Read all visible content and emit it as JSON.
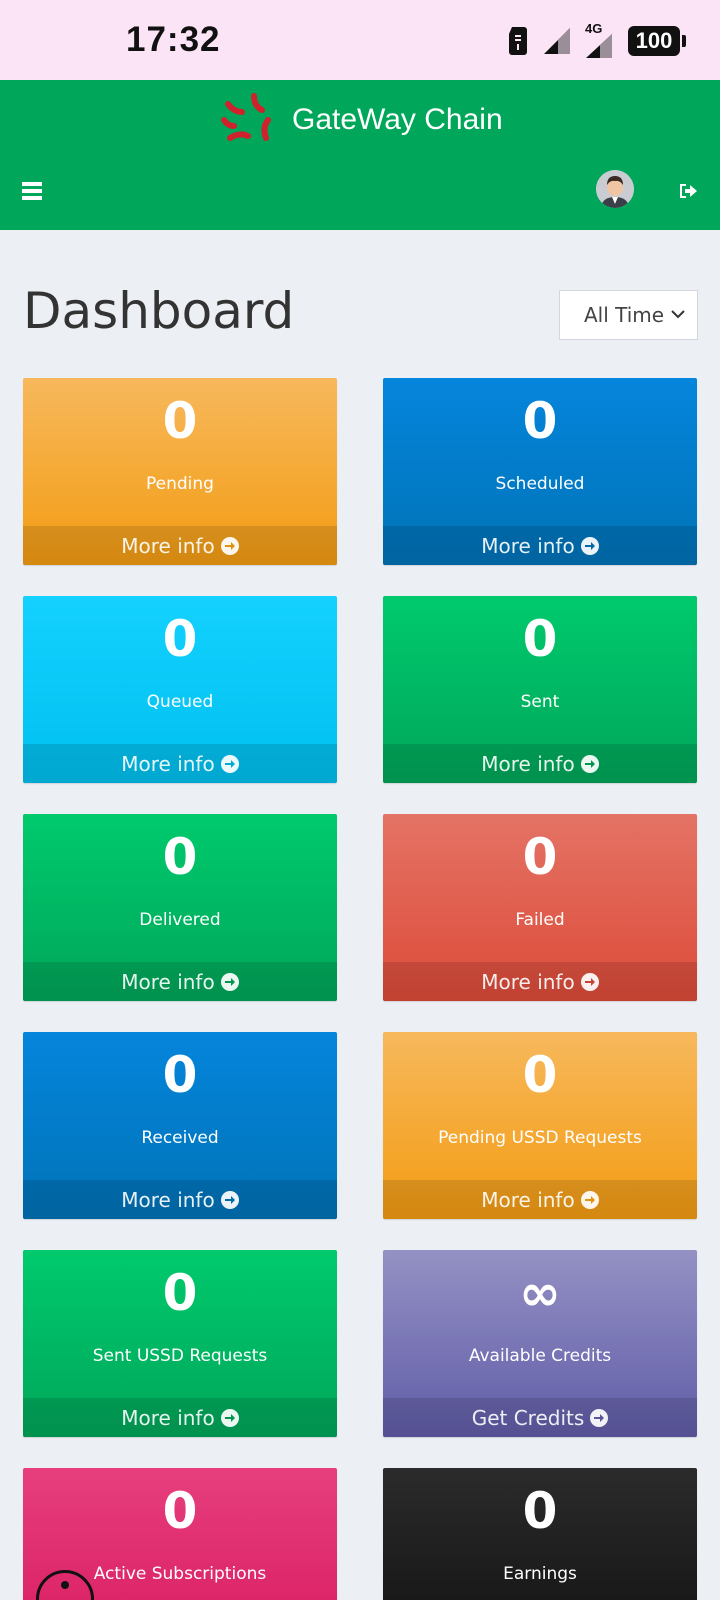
{
  "status_bar": {
    "time": "17:32",
    "network_label": "4G",
    "battery": "100"
  },
  "header": {
    "brand": "GateWay Chain",
    "brand_color": "#00a65a"
  },
  "page": {
    "title": "Dashboard",
    "range_select": "All Time"
  },
  "cards": [
    {
      "value": "0",
      "label": "Pending",
      "action": "More info",
      "color": "#f39c12"
    },
    {
      "value": "0",
      "label": "Scheduled",
      "action": "More info",
      "color": "#0073b7"
    },
    {
      "value": "0",
      "label": "Queued",
      "action": "More info",
      "color": "#00c0ef"
    },
    {
      "value": "0",
      "label": "Sent",
      "action": "More info",
      "color": "#00a65a"
    },
    {
      "value": "0",
      "label": "Delivered",
      "action": "More info",
      "color": "#00a65a"
    },
    {
      "value": "0",
      "label": "Failed",
      "action": "More info",
      "color": "#dd4b39"
    },
    {
      "value": "0",
      "label": "Received",
      "action": "More info",
      "color": "#0073b7"
    },
    {
      "value": "0",
      "label": "Pending USSD Requests",
      "action": "More info",
      "color": "#f39c12"
    },
    {
      "value": "0",
      "label": "Sent USSD Requests",
      "action": "More info",
      "color": "#00a65a"
    },
    {
      "value": "∞",
      "label": "Available Credits",
      "action": "Get Credits",
      "color": "#605ca8"
    },
    {
      "value": "0",
      "label": "Active Subscriptions",
      "color": "#d81b60"
    },
    {
      "value": "0",
      "label": "Earnings",
      "color": "#111111"
    }
  ]
}
